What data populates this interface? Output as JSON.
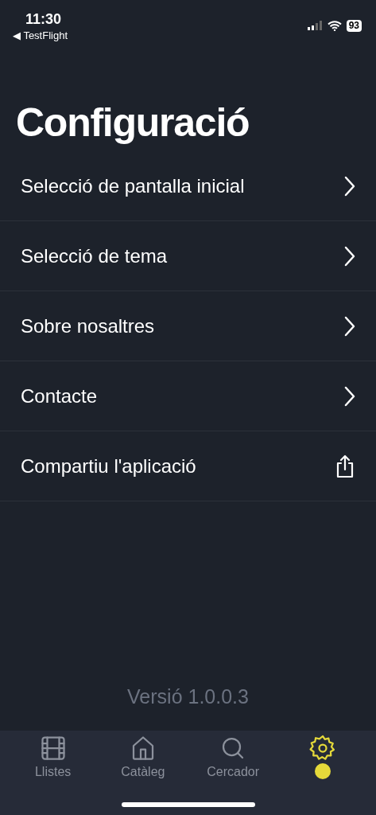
{
  "status_bar": {
    "time": "11:30",
    "back_label": "◀ TestFlight",
    "battery": "93"
  },
  "title": "Configuració",
  "menu": [
    {
      "label": "Selecció de pantalla inicial",
      "kind": "link"
    },
    {
      "label": "Selecció de tema",
      "kind": "link"
    },
    {
      "label": "Sobre nosaltres",
      "kind": "link"
    },
    {
      "label": "Contacte",
      "kind": "link"
    },
    {
      "label": "Compartiu l'aplicació",
      "kind": "share"
    }
  ],
  "version": "Versió 1.0.0.3",
  "tab_bar": [
    {
      "label": "Llistes",
      "selected": false
    },
    {
      "label": "Catàleg",
      "selected": false
    },
    {
      "label": "Cercador",
      "selected": false
    },
    {
      "selected": true
    }
  ]
}
